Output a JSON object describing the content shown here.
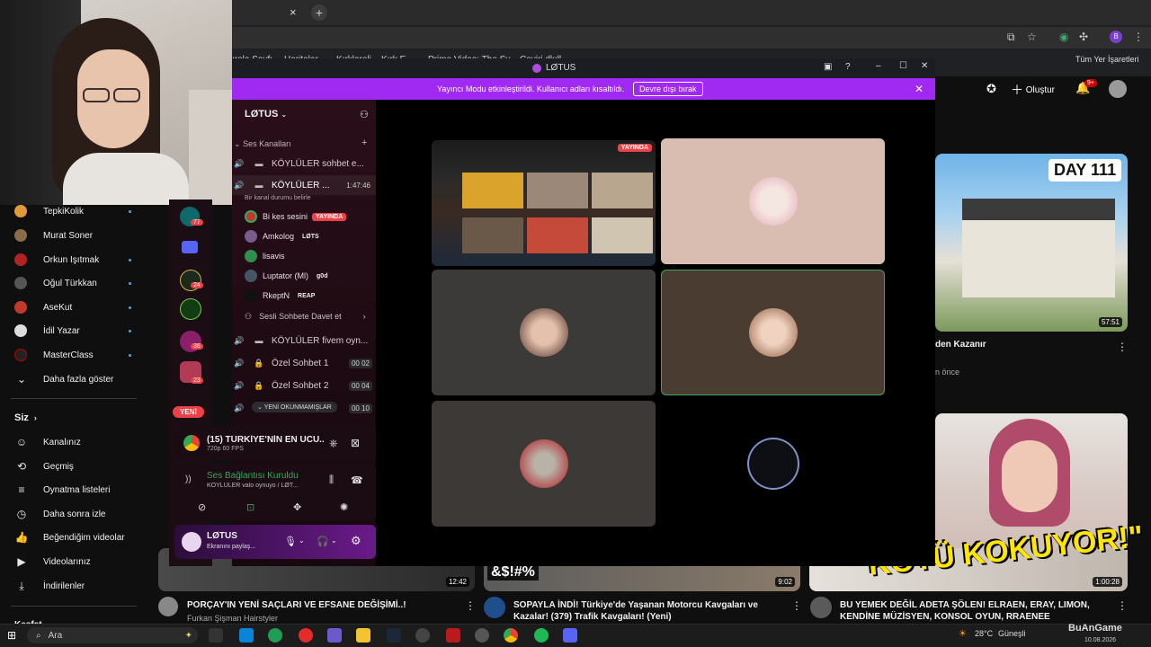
{
  "browser": {
    "tab_close": "×",
    "new_tab": "+",
    "bookmark_all": "Tüm Yer İşaretleri",
    "bookmarks": [
      "ırola Sayfı",
      "Haritalar",
      "Kırklareli – Kırk E...",
      "Prime Video: The Sy...",
      "Ceviri dkıll..."
    ]
  },
  "youtube": {
    "create_label": "Oluştur",
    "notif_badge": "9+",
    "subscriptions": [
      {
        "name": "TepkiKolik",
        "color": "#e09a3a"
      },
      {
        "name": "Murat Soner",
        "color": "#8a6b4a"
      },
      {
        "name": "Orkun Işıtmak",
        "color": "#b22222"
      },
      {
        "name": "Oğul Türkkan",
        "color": "#555555"
      },
      {
        "name": "AseKut",
        "color": "#c0392b"
      },
      {
        "name": "İdil Yazar",
        "color": "#dddddd"
      },
      {
        "name": "MasterClass",
        "color": "#222222"
      }
    ],
    "show_more": "Daha fazla göster",
    "you_section": "Siz",
    "you_items": [
      {
        "label": "Kanalınız",
        "icon": "channel-icon",
        "glyph": "☺"
      },
      {
        "label": "Geçmiş",
        "icon": "history-icon",
        "glyph": "⟲"
      },
      {
        "label": "Oynatma listeleri",
        "icon": "playlist-icon",
        "glyph": "≡"
      },
      {
        "label": "Daha sonra izle",
        "icon": "clock-icon",
        "glyph": "◷"
      },
      {
        "label": "Beğendiğim videolar",
        "icon": "thumbs-up-icon",
        "glyph": "👍"
      },
      {
        "label": "Videolarınız",
        "icon": "video-icon",
        "glyph": "▶"
      },
      {
        "label": "İndirilenler",
        "icon": "download-icon",
        "glyph": "⤓"
      }
    ],
    "explore_heading": "Keşfet",
    "right_video": {
      "title_partial": "den Kazanır",
      "meta_partial": "n önce",
      "duration": "57:51",
      "thumb_text": "DAY 111"
    },
    "right_video2": {
      "thumb_text": "KÖTÜ KOKUYOR!\"",
      "duration": "1:00:28"
    },
    "bottom_videos": [
      {
        "title": "PORÇAY'IN YENİ SAÇLARI VE EFSANE DEĞİŞİMİ..!",
        "channel": "Furkan Şişman Hairstyler",
        "duration": "12:42"
      },
      {
        "title": "SOPAYLA İNDİ! Türkiye'de Yaşanan Motorcu Kavgaları ve Kazalar! (379) Trafik Kavgaları! (Yeni)",
        "channel": "",
        "duration": "9:02",
        "thumb_text": "&$!#%"
      },
      {
        "title": "BU YEMEK DEĞİL ADETA ŞÖLEN! ELRAEN, ERAY, LIMON, KENDİNE MÜZİSYEN, KONSOL OYUN, RRAENEE",
        "channel": "",
        "duration": "1:00:28"
      }
    ]
  },
  "discord": {
    "window_title": "LØTUS",
    "banner_text": "Yayıncı Modu etkinleştirildi. Kullanıcı adları kısaltıldı.",
    "banner_button": "Devre dışı bırak",
    "server_name": "LØTUS",
    "category": "Ses Kanalları",
    "channels": [
      {
        "name": "KÖYLÜLER sohbet e...",
        "timer": ""
      },
      {
        "name": "KÖYLÜLER ...",
        "timer": "1:47:46",
        "status": "Bir kanal durumu belirle"
      }
    ],
    "users": [
      {
        "name": "Bi kes sesini",
        "tag": "YAYINDA",
        "color": "#c0392b"
      },
      {
        "name": "Amkolog",
        "tag": "LØTS",
        "color": "#7a5b8c"
      },
      {
        "name": "lisavis",
        "tag": "",
        "color": "#2f8f4f"
      },
      {
        "name": "Luptator (Ml)",
        "tag": "g0d",
        "color": "#445566"
      },
      {
        "name": "RkeptN",
        "tag": "REAP",
        "color": "#111111"
      }
    ],
    "invite_label": "Sesli Sohbete Davet et",
    "more_channels": [
      {
        "name": "KÖYLÜLER fivem oyn...",
        "counts": ""
      },
      {
        "name": "Özel Sohbet 1",
        "counts": "00 02"
      },
      {
        "name": "Özel Sohbet 2",
        "counts": "00 04"
      },
      {
        "name": "",
        "counts": "00 10"
      }
    ],
    "unread_label": "YENİ OKUNMAMIŞLAR",
    "new_badge": "YENİ",
    "stream_title": "(15) TÜRKİYE'NİN EN UCU...",
    "stream_quality": "720p 60 FPS",
    "voice_connected": "Ses Bağlantısı Kuruldu",
    "voice_channel": "KÖYLÜLER valo oynuyo / LØT...",
    "user_name": "LØTUS",
    "user_status": "Ekranını paylaş...",
    "live_tag": "YAYINDA",
    "guild_badges": [
      "77",
      "24",
      "36",
      "23"
    ]
  },
  "taskbar": {
    "search_label": "Ara",
    "weather": "28°C",
    "weather_desc": "Güneşli",
    "date": "10.08.2026",
    "watermark": "BuAnGame"
  },
  "colors": {
    "discord_banner": "#a12af2",
    "live_red": "#ed4245",
    "speaking_green": "#3ba55c",
    "yt_red": "#cc0000"
  }
}
